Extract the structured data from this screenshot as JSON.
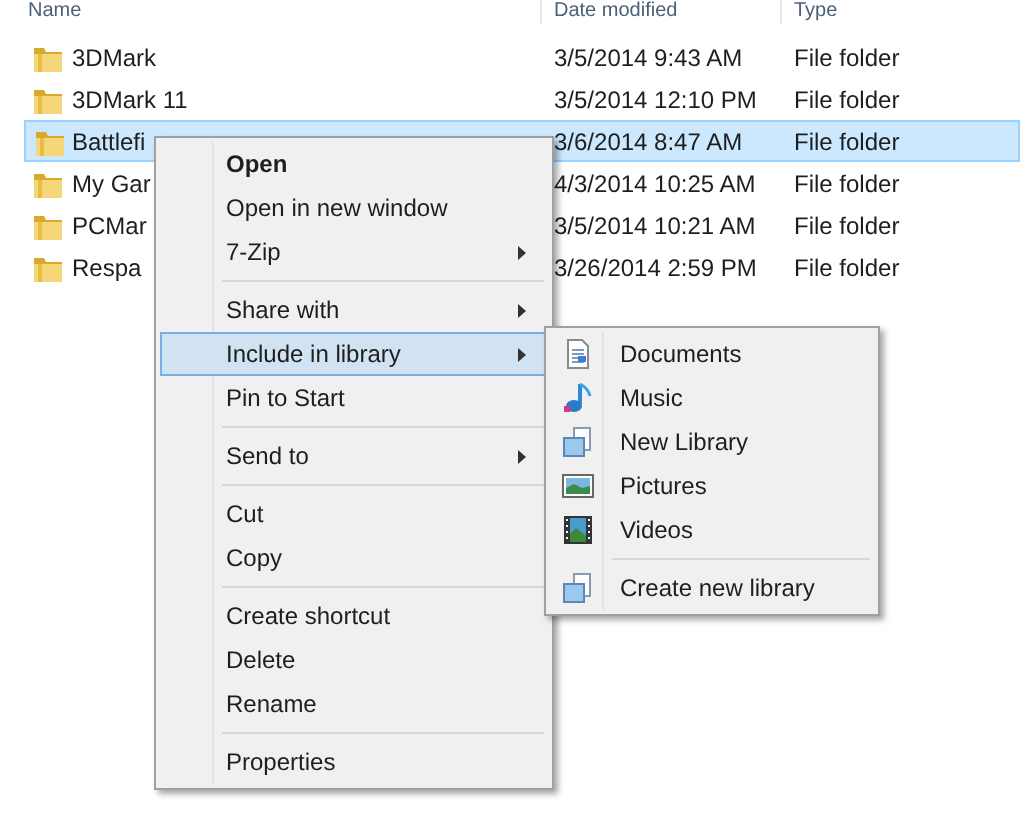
{
  "columns": [
    {
      "label": "Name"
    },
    {
      "label": "Date modified"
    },
    {
      "label": "Type"
    }
  ],
  "files": [
    {
      "name": "3DMark",
      "date": "3/5/2014 9:43 AM",
      "type": "File folder",
      "selected": false
    },
    {
      "name": "3DMark 11",
      "date": "3/5/2014 12:10 PM",
      "type": "File folder",
      "selected": false
    },
    {
      "name": "Battlefi",
      "date": "3/6/2014 8:47 AM",
      "type": "File folder",
      "selected": true
    },
    {
      "name": "My Gar",
      "date": "4/3/2014 10:25 AM",
      "type": "File folder",
      "selected": false
    },
    {
      "name": "PCMar",
      "date": "3/5/2014 10:21 AM",
      "type": "File folder",
      "selected": false
    },
    {
      "name": "Respa",
      "date": "3/26/2014 2:59 PM",
      "type": "File folder",
      "selected": false
    }
  ],
  "context_menu": [
    {
      "kind": "item",
      "label": "Open",
      "default": true,
      "submenu": false,
      "selected": false
    },
    {
      "kind": "item",
      "label": "Open in new window",
      "default": false,
      "submenu": false,
      "selected": false
    },
    {
      "kind": "item",
      "label": "7-Zip",
      "default": false,
      "submenu": true,
      "selected": false
    },
    {
      "kind": "separator"
    },
    {
      "kind": "item",
      "label": "Share with",
      "default": false,
      "submenu": true,
      "selected": false
    },
    {
      "kind": "item",
      "label": "Include in library",
      "default": false,
      "submenu": true,
      "selected": true
    },
    {
      "kind": "item",
      "label": "Pin to Start",
      "default": false,
      "submenu": false,
      "selected": false
    },
    {
      "kind": "separator"
    },
    {
      "kind": "item",
      "label": "Send to",
      "default": false,
      "submenu": true,
      "selected": false
    },
    {
      "kind": "separator"
    },
    {
      "kind": "item",
      "label": "Cut",
      "default": false,
      "submenu": false,
      "selected": false
    },
    {
      "kind": "item",
      "label": "Copy",
      "default": false,
      "submenu": false,
      "selected": false
    },
    {
      "kind": "separator"
    },
    {
      "kind": "item",
      "label": "Create shortcut",
      "default": false,
      "submenu": false,
      "selected": false
    },
    {
      "kind": "item",
      "label": "Delete",
      "default": false,
      "submenu": false,
      "selected": false
    },
    {
      "kind": "item",
      "label": "Rename",
      "default": false,
      "submenu": false,
      "selected": false
    },
    {
      "kind": "separator"
    },
    {
      "kind": "item",
      "label": "Properties",
      "default": false,
      "submenu": false,
      "selected": false
    }
  ],
  "submenu": [
    {
      "kind": "item",
      "label": "Documents"
    },
    {
      "kind": "item",
      "label": "Music"
    },
    {
      "kind": "item",
      "label": "New Library"
    },
    {
      "kind": "item",
      "label": "Pictures"
    },
    {
      "kind": "item",
      "label": "Videos"
    },
    {
      "kind": "separator"
    },
    {
      "kind": "item",
      "label": "Create new library"
    }
  ]
}
